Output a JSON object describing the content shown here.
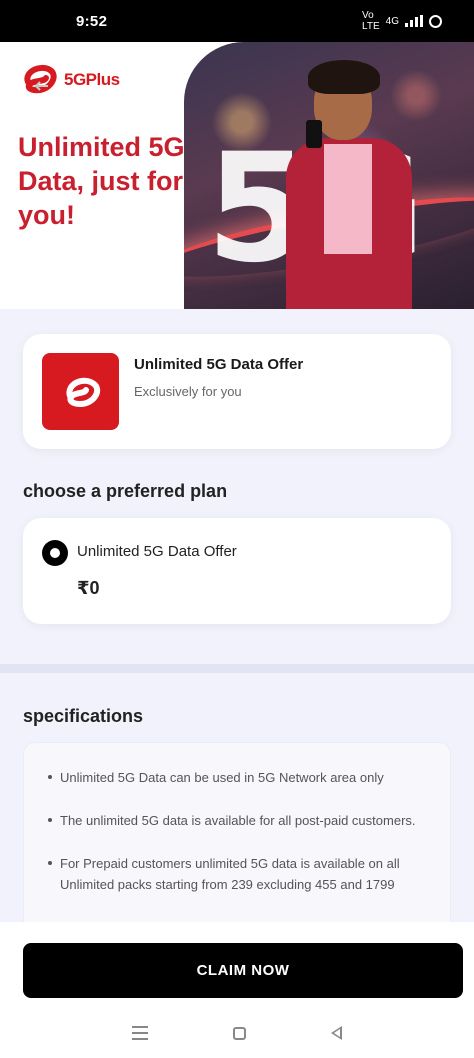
{
  "status_bar": {
    "time": "9:52",
    "network_label": "4G",
    "icons": [
      "volte-icon",
      "signal-icon",
      "battery-icon"
    ]
  },
  "banner": {
    "brand": "5GPlus",
    "headline": "Unlimited 5G Data, just for you!",
    "art_text": "5G",
    "accent_color": "#c8202e"
  },
  "offer": {
    "title": "Unlimited 5G Data Offer",
    "subtitle": "Exclusively for you",
    "icon": "airtel-logo-icon",
    "icon_color": "#d71920"
  },
  "plan_section": {
    "heading": "choose a preferred plan",
    "plans": [
      {
        "name": "Unlimited 5G Data Offer",
        "price": "₹0",
        "selected": true
      }
    ]
  },
  "specifications": {
    "heading": "specifications",
    "items": [
      "Unlimited 5G Data can be used in 5G Network area only",
      "The unlimited 5G data is available for all post-paid customers.",
      "For Prepaid customers unlimited 5G data is available on all Unlimited packs starting from 239 excluding 455 and 1799"
    ]
  },
  "cta": {
    "label": "CLAIM NOW"
  },
  "nav": {
    "icons": [
      "menu-icon",
      "home-icon",
      "back-icon"
    ]
  }
}
